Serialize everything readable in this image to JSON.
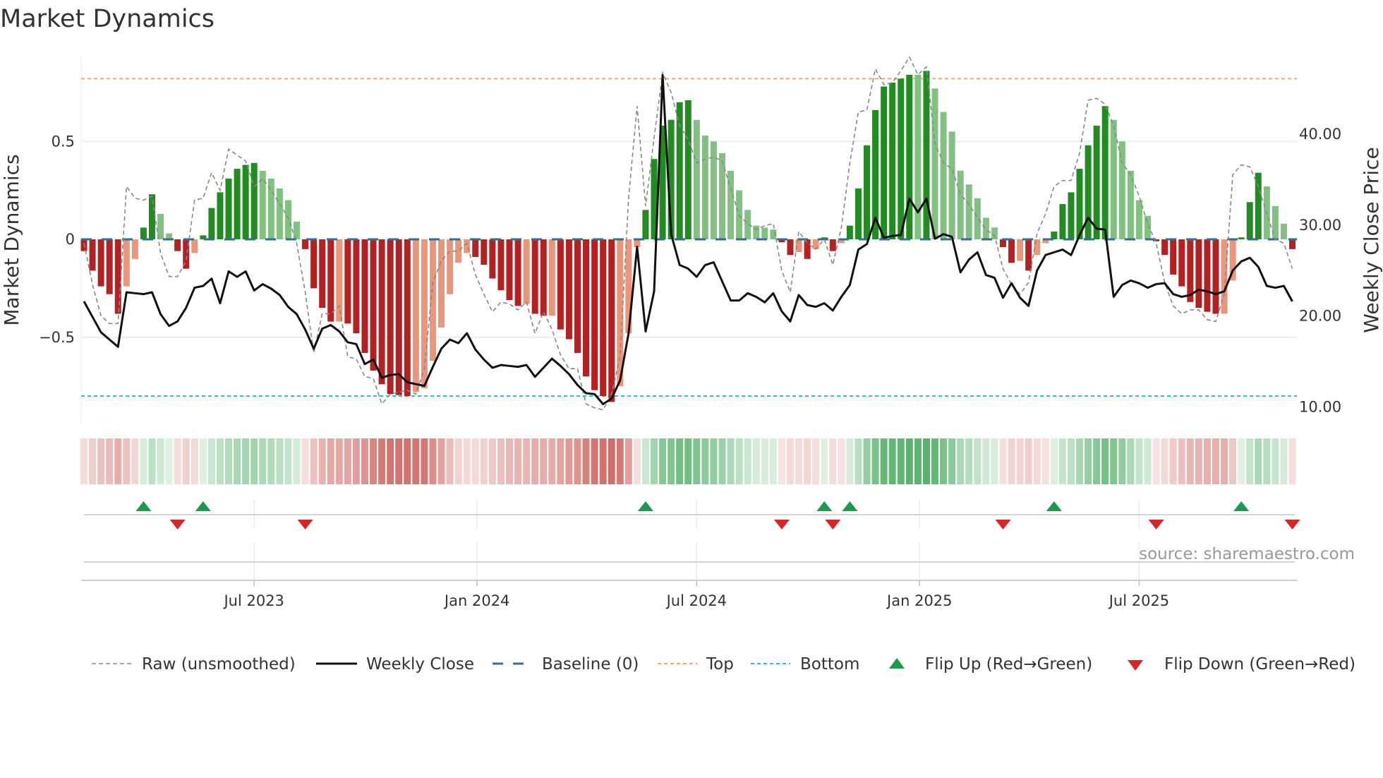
{
  "chart_data": {
    "type": "bar",
    "title": "Market Dynamics",
    "ylabel": "Market Dynamics",
    "y2label": "Weekly Close Price",
    "ylim": [
      -0.93,
      0.93
    ],
    "y2lim": [
      8.35,
      48.4
    ],
    "yticks": [
      {
        "value": 0.5,
        "label": "0.5"
      },
      {
        "value": 0,
        "label": "0"
      },
      {
        "value": -0.5,
        "label": "−0.5"
      }
    ],
    "y2ticks": [
      {
        "value": 40,
        "label": "40.00"
      },
      {
        "value": 30,
        "label": "30.00"
      },
      {
        "value": 20,
        "label": "20.00"
      },
      {
        "value": 10,
        "label": "10.00"
      }
    ],
    "x_unit": "week index",
    "xticks": [
      {
        "week": 20,
        "label": "Jul 2023"
      },
      {
        "week": 46.2,
        "label": "Jan 2024"
      },
      {
        "week": 72,
        "label": "Jul 2024"
      },
      {
        "week": 98.2,
        "label": "Jan 2025"
      },
      {
        "week": 124,
        "label": "Jul 2025"
      }
    ],
    "reference_lines": {
      "baseline": 0,
      "top": 0.82,
      "bottom": -0.8
    },
    "series": [
      {
        "name": "Market Dynamics (smoothed bars)",
        "axis": "left",
        "values": [
          -0.06,
          -0.16,
          -0.24,
          -0.28,
          -0.38,
          -0.24,
          -0.1,
          0.06,
          0.23,
          0.13,
          0.03,
          -0.06,
          -0.15,
          -0.07,
          0.02,
          0.16,
          0.24,
          0.31,
          0.36,
          0.38,
          0.39,
          0.35,
          0.31,
          0.26,
          0.2,
          0.09,
          -0.05,
          -0.25,
          -0.35,
          -0.42,
          -0.42,
          -0.43,
          -0.48,
          -0.58,
          -0.67,
          -0.74,
          -0.79,
          -0.795,
          -0.8,
          -0.78,
          -0.76,
          -0.62,
          -0.45,
          -0.28,
          -0.12,
          -0.07,
          -0.09,
          -0.13,
          -0.2,
          -0.26,
          -0.31,
          -0.34,
          -0.33,
          -0.38,
          -0.39,
          -0.39,
          -0.46,
          -0.51,
          -0.58,
          -0.7,
          -0.77,
          -0.8,
          -0.83,
          -0.75,
          -0.48,
          -0.04,
          0.15,
          0.41,
          0.58,
          0.61,
          0.7,
          0.71,
          0.61,
          0.53,
          0.5,
          0.44,
          0.35,
          0.25,
          0.15,
          0.07,
          0.06,
          0.05,
          -0.015,
          -0.08,
          -0.065,
          -0.1,
          -0.05,
          0.01,
          -0.06,
          -0.02,
          0.07,
          0.26,
          0.48,
          0.66,
          0.78,
          0.8,
          0.82,
          0.84,
          0.84,
          0.86,
          0.77,
          0.65,
          0.55,
          0.35,
          0.28,
          0.21,
          0.11,
          0.06,
          -0.04,
          -0.12,
          -0.11,
          -0.16,
          -0.08,
          -0.02,
          0.04,
          0.18,
          0.24,
          0.36,
          0.48,
          0.58,
          0.68,
          0.61,
          0.5,
          0.35,
          0.2,
          0.12,
          -0.01,
          -0.08,
          -0.18,
          -0.24,
          -0.32,
          -0.35,
          -0.37,
          -0.38,
          -0.38,
          -0.21,
          0.01,
          0.19,
          0.34,
          0.27,
          0.17,
          0.08,
          -0.05
        ]
      },
      {
        "name": "Raw (unsmoothed)",
        "axis": "left",
        "values": [
          -0.02,
          -0.23,
          -0.39,
          -0.43,
          -0.43,
          0.27,
          0.21,
          0.2,
          0.22,
          -0.07,
          -0.19,
          -0.19,
          -0.11,
          0.2,
          0.21,
          0.34,
          0.25,
          0.46,
          0.43,
          0.4,
          0.27,
          0.31,
          0.25,
          0.18,
          0.11,
          -0.02,
          -0.27,
          -0.58,
          -0.38,
          -0.38,
          -0.34,
          -0.6,
          -0.61,
          -0.7,
          -0.71,
          -0.84,
          -0.79,
          -0.78,
          -0.77,
          -0.79,
          -0.66,
          -0.22,
          -0.11,
          -0.06,
          -0.06,
          -0.02,
          -0.18,
          -0.28,
          -0.37,
          -0.32,
          -0.33,
          -0.36,
          -0.32,
          -0.48,
          -0.37,
          -0.46,
          -0.59,
          -0.66,
          -0.66,
          -0.84,
          -0.86,
          -0.87,
          -0.79,
          -0.6,
          0.21,
          0.68,
          0.17,
          0.52,
          0.85,
          0.75,
          0.58,
          0.51,
          0.39,
          0.41,
          0.42,
          0.4,
          0.26,
          0.12,
          0.08,
          0.05,
          0.07,
          0.08,
          -0.16,
          -0.27,
          0.04,
          -0.02,
          -0.05,
          0.0,
          -0.13,
          0.06,
          0.39,
          0.65,
          0.66,
          0.87,
          0.79,
          0.8,
          0.86,
          0.93,
          0.84,
          0.88,
          0.49,
          0.39,
          0.36,
          0.23,
          0.18,
          0.11,
          0.05,
          0.02,
          -0.15,
          -0.23,
          -0.28,
          -0.22,
          0.03,
          0.13,
          0.27,
          0.3,
          0.3,
          0.44,
          0.71,
          0.72,
          0.69,
          0.58,
          0.39,
          0.33,
          0.22,
          0.08,
          -0.02,
          -0.22,
          -0.34,
          -0.38,
          -0.36,
          -0.36,
          -0.41,
          -0.42,
          -0.28,
          0.33,
          0.38,
          0.37,
          0.27,
          0.13,
          0.0,
          -0.02,
          -0.15
        ]
      },
      {
        "name": "Weekly Close",
        "axis": "right",
        "values": [
          21.6,
          19.9,
          18.2,
          17.4,
          16.6,
          22.6,
          22.5,
          22.4,
          22.6,
          20.2,
          18.9,
          19.4,
          20.9,
          23.1,
          23.3,
          24.1,
          21.4,
          24.9,
          24.3,
          24.9,
          22.8,
          23.5,
          23.0,
          22.3,
          21.0,
          20.2,
          18.5,
          16.4,
          18.6,
          19.0,
          18.3,
          17.1,
          16.9,
          14.7,
          15.2,
          13.2,
          13.5,
          13.6,
          12.7,
          12.5,
          12.3,
          14.4,
          16.4,
          17.4,
          17.0,
          18.1,
          16.3,
          15.2,
          14.3,
          14.6,
          14.5,
          14.4,
          14.6,
          13.3,
          14.3,
          15.3,
          14.5,
          13.6,
          12.4,
          11.5,
          11.4,
          10.3,
          10.9,
          12.9,
          18.1,
          27.6,
          18.3,
          22.7,
          46.5,
          29.0,
          25.6,
          25.2,
          24.3,
          25.6,
          25.9,
          23.8,
          21.7,
          21.7,
          22.5,
          22.1,
          21.5,
          22.5,
          20.5,
          19.4,
          22.3,
          21.2,
          21.0,
          21.4,
          20.6,
          22.1,
          23.4,
          27.3,
          27.9,
          30.8,
          28.6,
          28.8,
          28.9,
          32.9,
          31.4,
          32.9,
          28.5,
          29.0,
          28.7,
          24.8,
          26.2,
          27.0,
          24.5,
          24.2,
          22.0,
          23.6,
          22.0,
          21.1,
          25.0,
          26.7,
          27.0,
          27.3,
          26.7,
          28.9,
          30.8,
          29.6,
          29.5,
          22.1,
          23.4,
          23.9,
          23.6,
          23.1,
          23.5,
          23.6,
          22.4,
          22.1,
          22.3,
          22.9,
          22.7,
          22.4,
          22.7,
          25.0,
          26.0,
          26.4,
          25.4,
          23.3,
          23.1,
          23.3,
          21.6
        ]
      }
    ],
    "flips": {
      "up": [
        7,
        14,
        66,
        87,
        90,
        114,
        136
      ],
      "down": [
        11,
        26,
        82,
        88,
        108,
        126,
        142
      ]
    },
    "legend": {
      "placement": "bottom",
      "items": [
        {
          "label": "Raw (unsmoothed)"
        },
        {
          "label": "Weekly Close"
        },
        {
          "label": "Baseline (0)"
        },
        {
          "label": "Top"
        },
        {
          "label": "Bottom"
        },
        {
          "label": "Flip Up (Red→Green)"
        },
        {
          "label": "Flip Down (Green→Red)"
        }
      ]
    },
    "source": "source: sharemaestro.com"
  },
  "colors": {
    "strong_green": "#228b22",
    "light_green": "#82c182",
    "strong_red": "#b22222",
    "light_red": "#e9967a",
    "close_line": "#111111",
    "raw_line": "#888888",
    "baseline": "#2f6f9f",
    "top": "#f0a860",
    "bottom": "#22c3d6",
    "flip_up": "#1a9a4a",
    "flip_down": "#d62728"
  }
}
